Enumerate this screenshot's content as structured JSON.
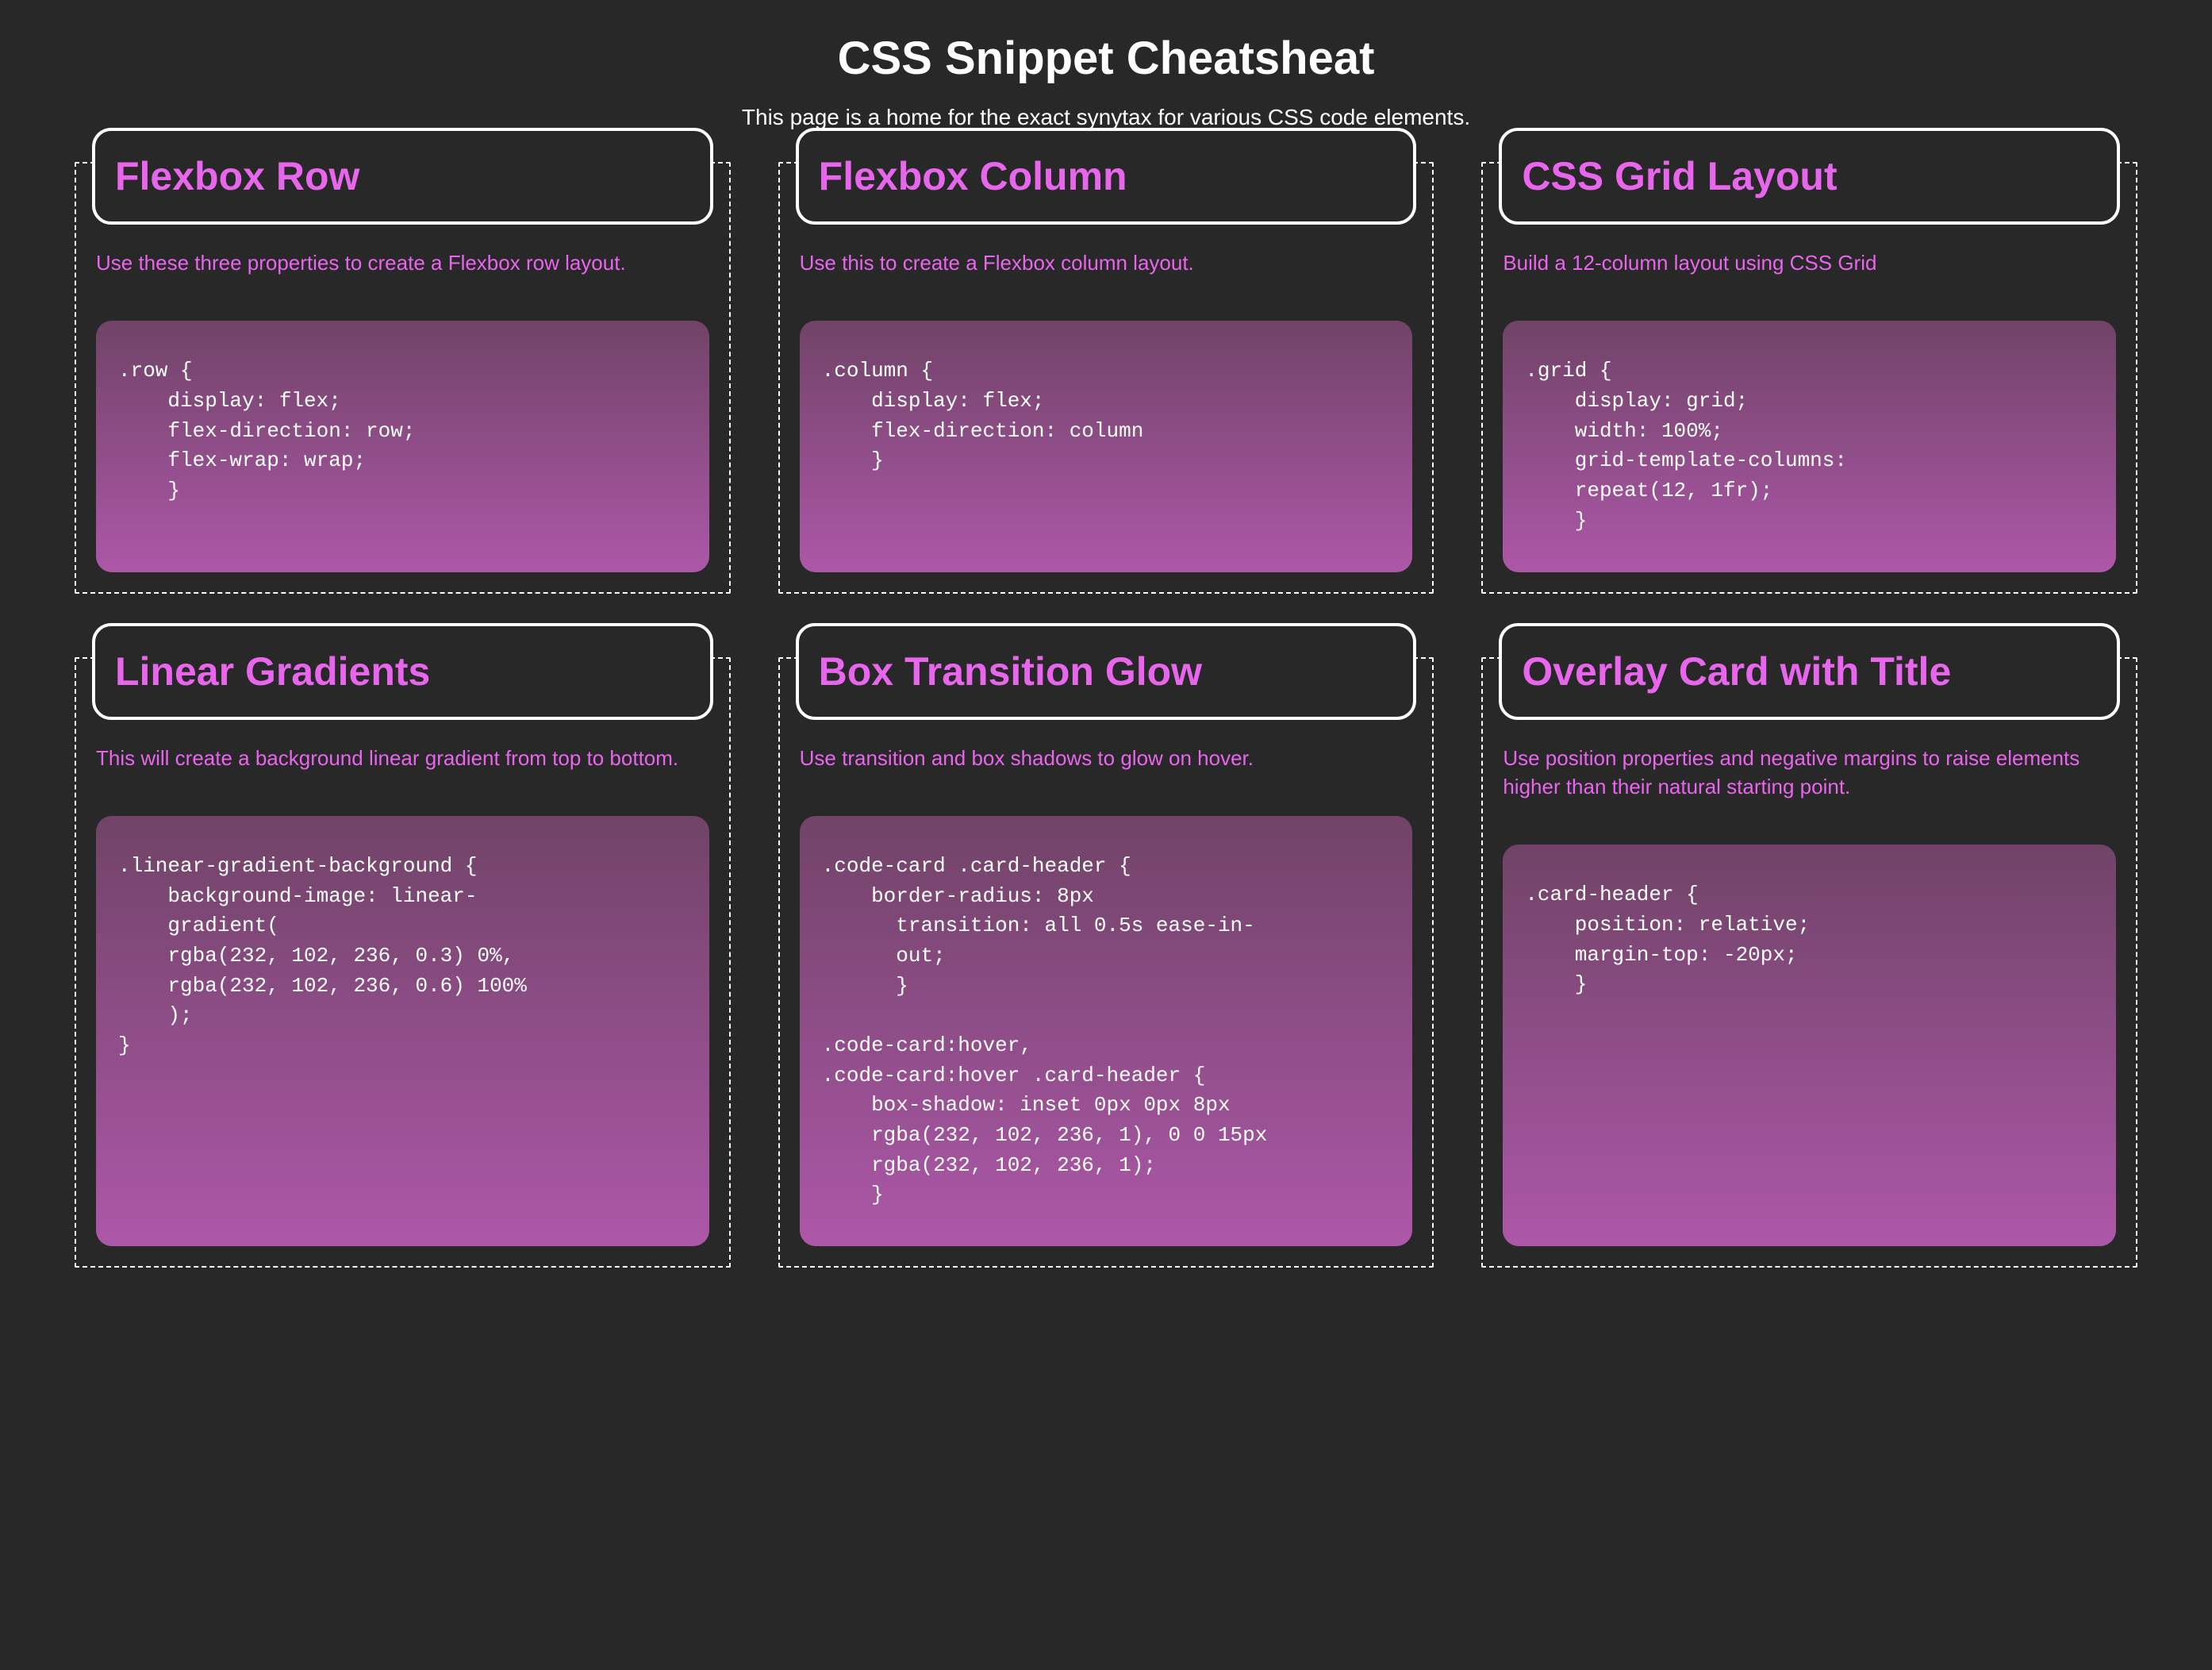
{
  "page": {
    "title": "CSS Snippet Cheatsheat",
    "subtitle": "This page is a home for the exact synytax for various CSS code elements."
  },
  "cards": [
    {
      "title": "Flexbox Row",
      "description": "Use these three properties to create a Flexbox row layout.",
      "code": ".row {\n    display: flex;\n    flex-direction: row;\n    flex-wrap: wrap;\n    }"
    },
    {
      "title": "Flexbox Column",
      "description": "Use this to create a Flexbox column layout.",
      "code": ".column {\n    display: flex;\n    flex-direction: column\n    }"
    },
    {
      "title": "CSS Grid Layout",
      "description": "Build a 12-column layout using CSS Grid",
      "code": ".grid {\n    display: grid;\n    width: 100%;\n    grid-template-columns:\n    repeat(12, 1fr);\n    }"
    },
    {
      "title": "Linear Gradients",
      "description": "This will create a background linear gradient from top to bottom.",
      "code": ".linear-gradient-background {\n    background-image: linear-\n    gradient(\n    rgba(232, 102, 236, 0.3) 0%,\n    rgba(232, 102, 236, 0.6) 100%\n    );\n}"
    },
    {
      "title": "Box Transition Glow",
      "description": "Use transition and box shadows to glow on hover.",
      "code": ".code-card .card-header {\n    border-radius: 8px\n      transition: all 0.5s ease-in-\n      out;\n      }\n\n.code-card:hover,\n.code-card:hover .card-header {\n    box-shadow: inset 0px 0px 8px\n    rgba(232, 102, 236, 1), 0 0 15px\n    rgba(232, 102, 236, 1);\n    }"
    },
    {
      "title": "Overlay Card with Title",
      "description": "Use position properties and negative margins to raise elements higher than their natural starting point.",
      "code": ".card-header {\n    position: relative;\n    margin-top: -20px;\n    }"
    }
  ]
}
